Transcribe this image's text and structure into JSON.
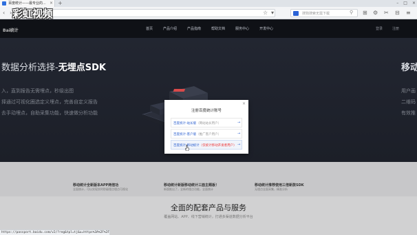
{
  "browser": {
    "tab_title": "百度统计——最专业的...",
    "new_tab_symbol": "+",
    "url": "",
    "search_placeholder": "搜狗搜索无需下载",
    "status_url": "https://passport.baidu.com/v2/?reg&tpl=tj&u=https%3A%2F%2Ftongji.baidu.com%2F"
  },
  "watermark": "彩虹视频",
  "site": {
    "logo": "Bai统计",
    "nav": [
      "首页",
      "产品介绍",
      "产品指南",
      "帮助文档",
      "服务中心",
      "开发中心"
    ],
    "nav_right": [
      "登录",
      "注册"
    ],
    "hero": {
      "title_prefix": "数据分析选择-",
      "title_bold": "无埋点SDK",
      "lines": [
        "入，直到报告无需埋点，秒级出图",
        "择通过可视化圈选定义埋点，完善自定义报告",
        "去手动埋点，自助采集功能，快速做分析功能"
      ],
      "right_title": "移动",
      "right_lines": [
        "用户画",
        "二维码",
        "有效推"
      ]
    },
    "features": [
      {
        "title": "移动统计全新版本APP两倍功",
        "desc": "全面统计，可以实现实时秒级埋点埋点可视化"
      },
      {
        "title": "移动统计新版移动统计三面主题板！",
        "desc": "新版推出了，全新的埋点功能，全面统计"
      },
      {
        "title": "移动统计推荐使用三倍新款SDK",
        "desc": "无埋点全面采集，精准分析"
      }
    ],
    "products_title": "全面的配套产品与服务",
    "products_sub": "覆盖网站、APP、线下营销统计，打通多渠道数据分析平台"
  },
  "modal": {
    "close": "×",
    "title": "注册百度统计账号",
    "options": [
      {
        "label": "百度统计-站长版",
        "hint": "（网站站长用户）",
        "arrow": "→",
        "active": false,
        "red": false
      },
      {
        "label": "百度统计-客户版",
        "hint": "（推广客户用户）",
        "arrow": "→",
        "active": false,
        "red": false
      },
      {
        "label": "百度统计-移动统计",
        "hint": "（仅统计移动开发者用户）",
        "arrow": "→",
        "active": true,
        "red": true
      }
    ]
  }
}
